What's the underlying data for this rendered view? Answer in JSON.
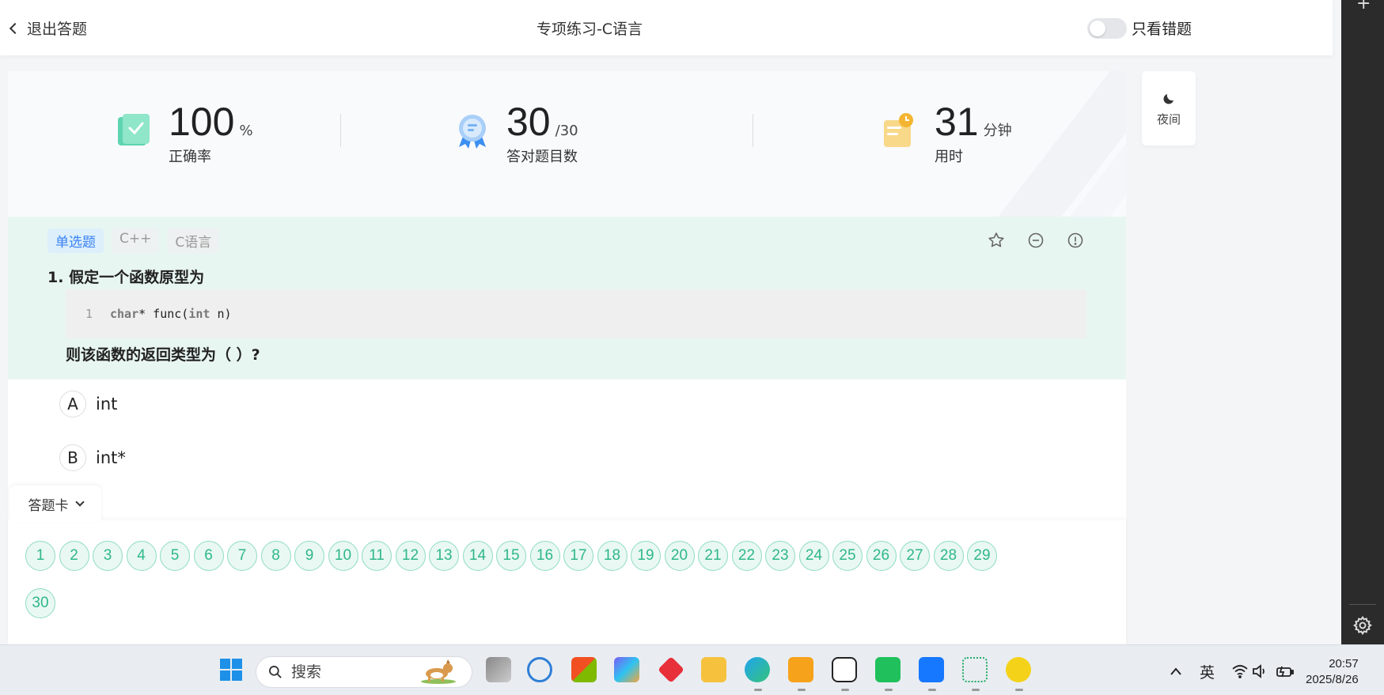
{
  "header": {
    "back_label": "退出答题",
    "title": "专项练习-C语言",
    "toggle_label": "只看错题"
  },
  "stats": {
    "accuracy": {
      "value": "100",
      "unit": "%",
      "label": "正确率"
    },
    "correct": {
      "value": "30",
      "unit": "/30",
      "label": "答对题目数"
    },
    "time": {
      "value": "31",
      "unit": "分钟",
      "label": "用时"
    }
  },
  "night_mode": {
    "label": "夜间"
  },
  "question": {
    "tags": [
      "单选题",
      "C++",
      "C语言"
    ],
    "number": "1.",
    "title": "假定一个函数原型为",
    "code_line_no": "1",
    "code_kw1": "char",
    "code_mid": "* func(",
    "code_kw2": "int",
    "code_end": " n)",
    "tail": "则该函数的返回类型为（ ）?"
  },
  "options": [
    {
      "letter": "A",
      "text": "int"
    },
    {
      "letter": "B",
      "text": "int*"
    }
  ],
  "answer_card": {
    "label": "答题卡",
    "numbers": [
      "1",
      "2",
      "3",
      "4",
      "5",
      "6",
      "7",
      "8",
      "9",
      "10",
      "11",
      "12",
      "13",
      "14",
      "15",
      "16",
      "17",
      "18",
      "19",
      "20",
      "21",
      "22",
      "23",
      "24",
      "25",
      "26",
      "27",
      "28",
      "29",
      "30"
    ]
  },
  "taskbar": {
    "search_placeholder": "搜索",
    "ime": "英",
    "time": "20:57",
    "date": "2025/8/26"
  },
  "colors": {
    "accent_green": "#2fb78a",
    "question_bg": "#e8f6f2",
    "tag_blue": "#3b82f6"
  }
}
